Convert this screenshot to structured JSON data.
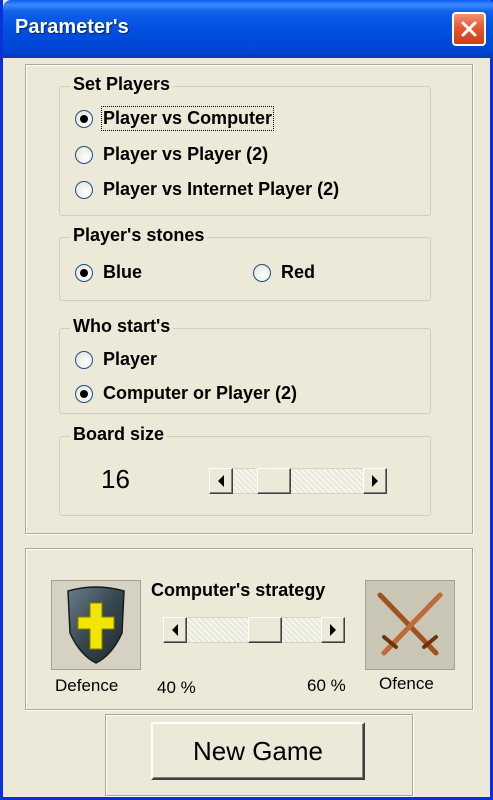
{
  "window": {
    "title": "Parameter's"
  },
  "players": {
    "legend": "Set Players",
    "options": [
      {
        "label": "Player vs Computer",
        "checked": true
      },
      {
        "label": "Player vs Player (2)",
        "checked": false
      },
      {
        "label": "Player vs Internet Player (2)",
        "checked": false
      }
    ]
  },
  "stones": {
    "legend": "Player's stones",
    "options": [
      {
        "label": "Blue",
        "checked": true
      },
      {
        "label": "Red",
        "checked": false
      }
    ]
  },
  "starts": {
    "legend": "Who start's",
    "options": [
      {
        "label": "Player",
        "checked": false
      },
      {
        "label": "Computer or Player (2)",
        "checked": true
      }
    ]
  },
  "board": {
    "legend": "Board size",
    "value": "16"
  },
  "strategy": {
    "title": "Computer's strategy",
    "defence_label": "Defence",
    "offence_label": "Ofence",
    "left_percent": "40 %",
    "right_percent": "60 %",
    "level": 0.6
  },
  "actions": {
    "new_game": "New Game"
  },
  "colors": {
    "titlebar": "#0046d5",
    "face": "#ece9d8",
    "close": "#e45a33"
  }
}
